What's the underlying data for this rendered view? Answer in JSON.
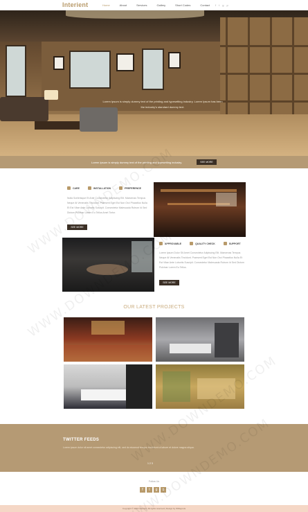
{
  "header": {
    "logo": "Interient",
    "nav": [
      "Home",
      "About",
      "Services",
      "Gallery",
      "Short Codes",
      "Contact"
    ],
    "active_nav": "Home",
    "social_icons": [
      "f",
      "t",
      "g",
      "p"
    ]
  },
  "hero": {
    "caption_line1": "Lorem Ipsum is simply dummy text of the printing and typesetting industry. Lorem Ipsum has been",
    "caption_line2": "the industry's standard dummy text.",
    "slides": 3,
    "active_slide": 1
  },
  "strip": {
    "text": "Lorem Ipsum is simply dummy text of the printing and typesetting industry.",
    "button": "SEE MORE"
  },
  "services_top": {
    "items": [
      "CARE",
      "INSTALLATION",
      "PREFERENCE"
    ],
    "text": "Nulla Scelerisque Et Ante Consectetur Adipiscing Elit. Maecenas Tempus Neque At Venenatis Tincidunt. Praesent Eget Est Non Orci Phasellus Nulla Et Est Vitae Ante Lobortis Suscipit. Consectetur Malesuada Rutrum Id Sed Dictum Pulvinar Lorem Eu Tellus Amet Tortor.",
    "button": "SEE MORE"
  },
  "services_bottom": {
    "items": [
      "APPROVABLE",
      "QUALITY CHECK",
      "SUPPORT"
    ],
    "text": "Lorem Ipsum Dolor Sit Amet Consectetur Adipiscing Elit. Maecenas Tempus Neque At Venenatis Tincidunt. Praesent Eget Est Non Orci Phasellus Nulla Et Est Vitae Ante Lobortis Suscipit. Consectetur Malesuada Rutrum Id Sed Dictum Pulvinar Lorem Eu Tellus.",
    "button": "SEE MORE"
  },
  "projects": {
    "title": "OUR LATEST PROJECTS"
  },
  "twitter": {
    "title": "TWITTER FEEDS",
    "text": "Lorem ipsum dolor sit amet consectetur adipiscing elit, sed do eiusmod tempor incididunt ut labore et dolore magna aliqua.",
    "pager": "1 2 3"
  },
  "footer": {
    "follow": "Follow Us",
    "socials": [
      "f",
      "t",
      "g",
      "p"
    ],
    "copyright": "Copyright © 2016 Interient. All rights reserved | Design by W3layouts"
  },
  "watermark": "WWW.DOWNDEMO.COM",
  "colors": {
    "accent": "#b89a6a",
    "band": "#b59a74",
    "dark_button": "#3b2f25"
  }
}
